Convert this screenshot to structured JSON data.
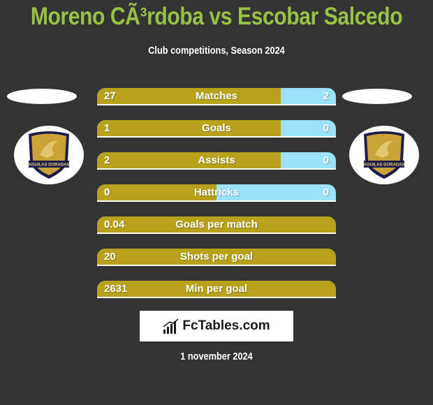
{
  "header": {
    "title": "Moreno CÃ³rdoba vs Escobar Salcedo",
    "subtitle": "Club competitions, Season 2024"
  },
  "teams": {
    "left": {
      "logo": "aguilas-doradas-crest",
      "logo_text": "AGUILAS DORADAS"
    },
    "right": {
      "logo": "aguilas-doradas-crest",
      "logo_text": "AGUILAS DORADAS"
    }
  },
  "colors": {
    "left_bar": "#b8a21c",
    "right_bar": "#99e2f8",
    "title": "#98c146",
    "background": "#333333"
  },
  "stats": [
    {
      "label": "Matches",
      "left": "27",
      "right": "2",
      "left_share": 0.77
    },
    {
      "label": "Goals",
      "left": "1",
      "right": "0",
      "left_share": 0.77
    },
    {
      "label": "Assists",
      "left": "2",
      "right": "0",
      "left_share": 0.77
    },
    {
      "label": "Hattricks",
      "left": "0",
      "right": "0",
      "left_share": 0.5
    },
    {
      "label": "Goals per match",
      "left": "0.04",
      "right": "",
      "left_share": 1.0
    },
    {
      "label": "Shots per goal",
      "left": "20",
      "right": "",
      "left_share": 1.0
    },
    {
      "label": "Min per goal",
      "left": "2631",
      "right": "",
      "left_share": 1.0
    }
  ],
  "footer": {
    "brand": "FcTables.com",
    "brand_icon": "bar-chart-icon",
    "date": "1 november 2024"
  }
}
